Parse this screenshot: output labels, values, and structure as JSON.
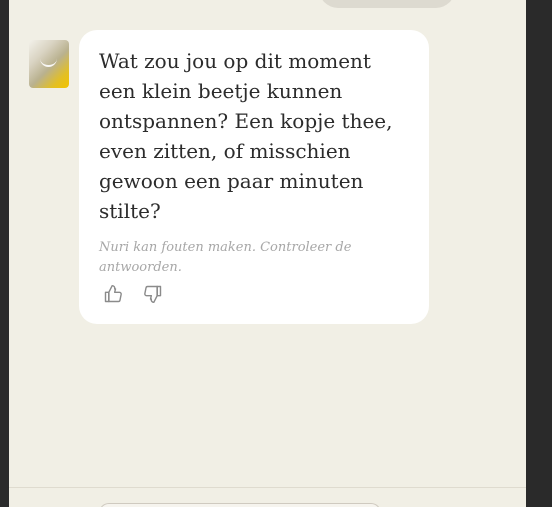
{
  "message": {
    "text": "Wat zou jou op dit moment\neen klein beetje kunnen\nontspannen? Een kopje thee,\neven zitten, of misschien\ngewoon een paar minuten\nstilte?",
    "disclaimer": "Nuri kan fouten maken. Controleer de antwoorden."
  },
  "icons": {
    "avatar": "nuri-avatar-icon",
    "like": "thumbs-up-icon",
    "dislike": "thumbs-down-icon"
  },
  "colors": {
    "background": "#f1efe5",
    "card": "#ffffff",
    "text": "#2c2c2c",
    "muted": "#a7a7a7",
    "avatar_accent": "#f2c300"
  }
}
